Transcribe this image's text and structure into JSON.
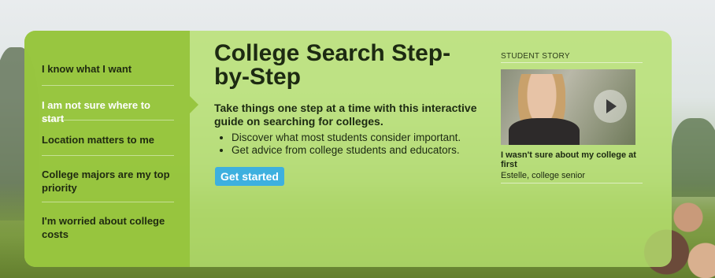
{
  "sidebar": {
    "items": [
      {
        "label": "I know what I want"
      },
      {
        "label": "I am not sure where to start"
      },
      {
        "label": "Location matters to me"
      },
      {
        "label": "College majors are my top priority"
      },
      {
        "label": "I'm worried about college costs"
      }
    ],
    "active_index": 1
  },
  "main": {
    "title": "College Search Step-by-Step",
    "intro": "Take things one step at a time with this interactive guide on searching for colleges.",
    "bullets": [
      "Discover what most students consider important.",
      "Get advice from college students and educators."
    ],
    "cta_label": "Get started"
  },
  "story": {
    "heading": "STUDENT STORY",
    "video_title": "I wasn't sure about my college at first",
    "author": "Estelle, college senior"
  },
  "colors": {
    "panel": "#b6e16e",
    "sidebar": "#96c43c",
    "button": "#3db0df"
  }
}
